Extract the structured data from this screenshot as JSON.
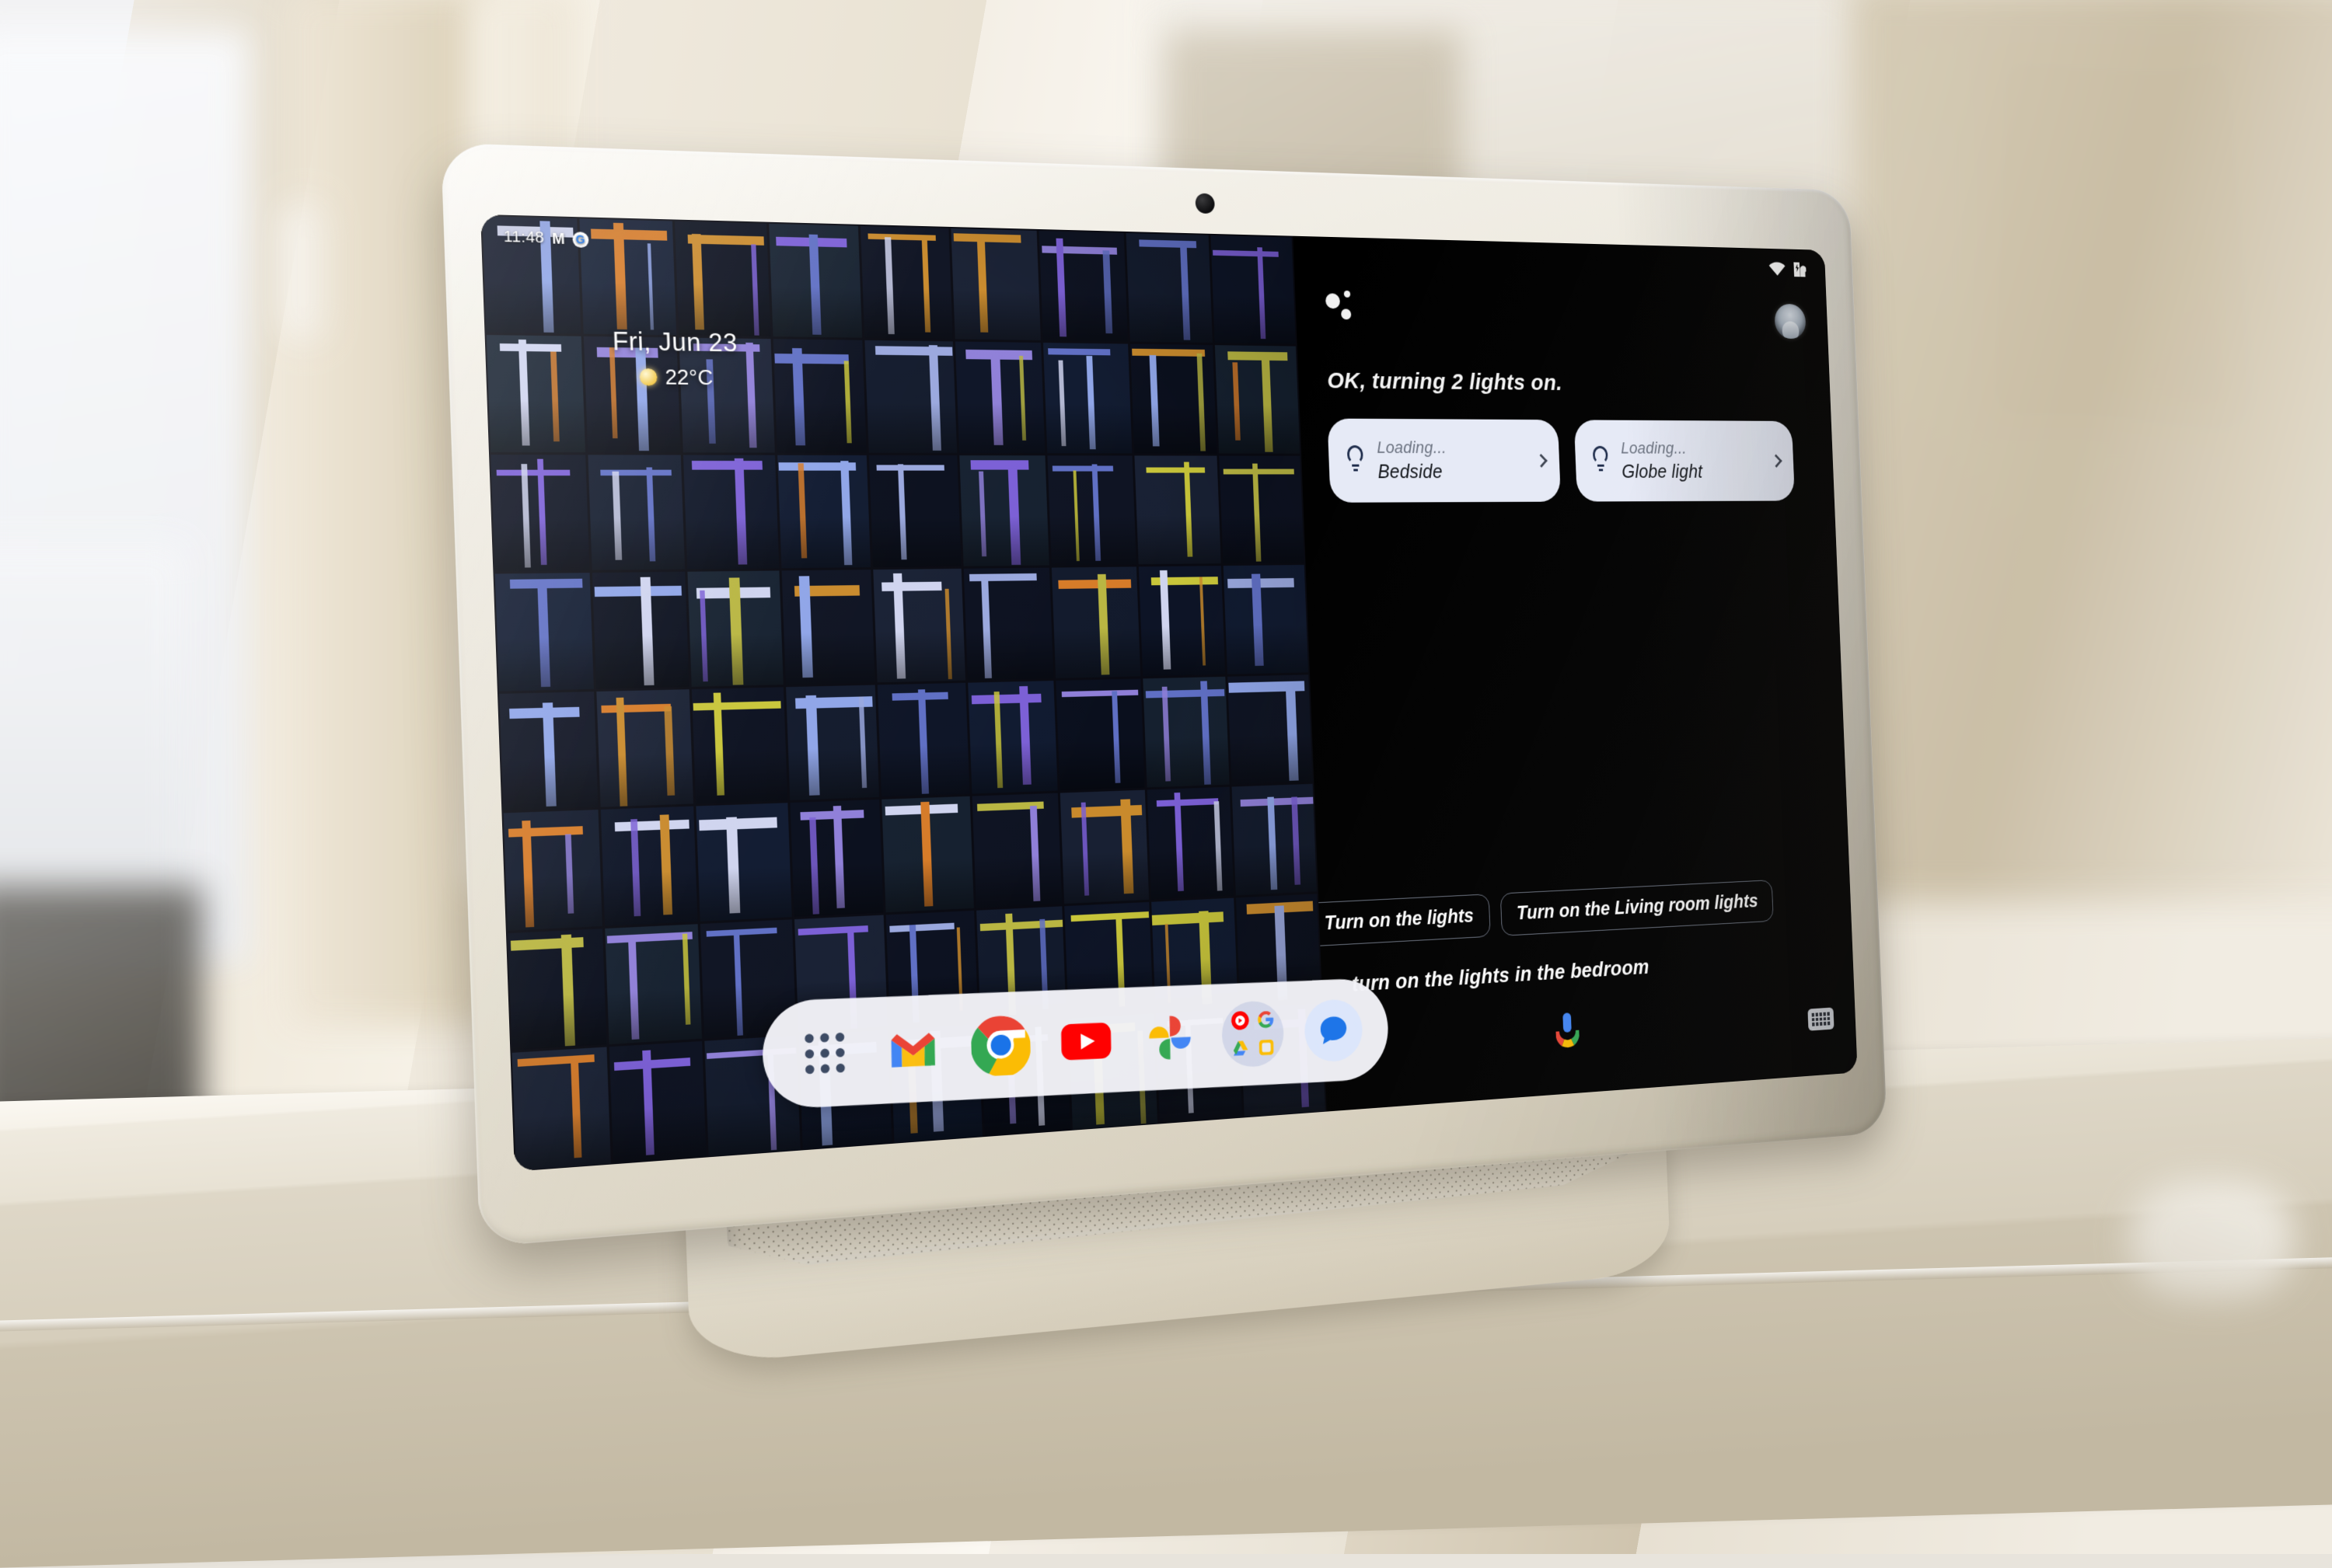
{
  "device": {
    "name": "Google Pixel Tablet with speaker dock",
    "camera": "front-camera"
  },
  "screen": {
    "status_bar_left": {
      "time": "11:48",
      "icons": [
        "gmail-icon",
        "google-icon"
      ],
      "gmail_glyph": "M",
      "google_glyph": "G"
    },
    "status_bar_right": {
      "icons": [
        "wifi-icon",
        "battery-charging-icon"
      ]
    },
    "clock_widget": {
      "date": "Fri, Jun 23",
      "weather_icon": "sun-icon",
      "temperature": "22°C"
    },
    "dock": {
      "items": [
        {
          "name": "app-drawer",
          "label": "All apps"
        },
        {
          "name": "gmail",
          "label": "Gmail"
        },
        {
          "name": "chrome",
          "label": "Chrome"
        },
        {
          "name": "youtube",
          "label": "YouTube"
        },
        {
          "name": "photos",
          "label": "Photos"
        },
        {
          "name": "google-folder",
          "label": "Google"
        },
        {
          "name": "messages",
          "label": "Messages"
        }
      ]
    }
  },
  "assistant": {
    "avatar": "user-avatar",
    "logo": "assistant-dots-icon",
    "response_text": "OK, turning 2 lights on.",
    "light_cards": [
      {
        "status": "Loading...",
        "name": "Bedside",
        "icon": "lightbulb-icon",
        "chevron": "chevron-right-icon"
      },
      {
        "status": "Loading...",
        "name": "Globe light",
        "icon": "lightbulb-icon",
        "chevron": "chevron-right-icon"
      }
    ],
    "suggestion_chips": [
      {
        "label": "Turn on the lights"
      },
      {
        "label": "Turn on the Living room lights"
      }
    ],
    "transcript": "turn on the lights in the bedroom",
    "mic_icon": "microphone-icon",
    "keyboard_icon": "keyboard-icon"
  },
  "colors": {
    "assistant_background": "#000000",
    "card_background": "#e6eaf6",
    "card_text": "#101318",
    "card_subtext": "#6b7280",
    "chip_border": "#6b7280",
    "device_body": "#e6e1d4",
    "accent_blue": "#1a73e8"
  }
}
